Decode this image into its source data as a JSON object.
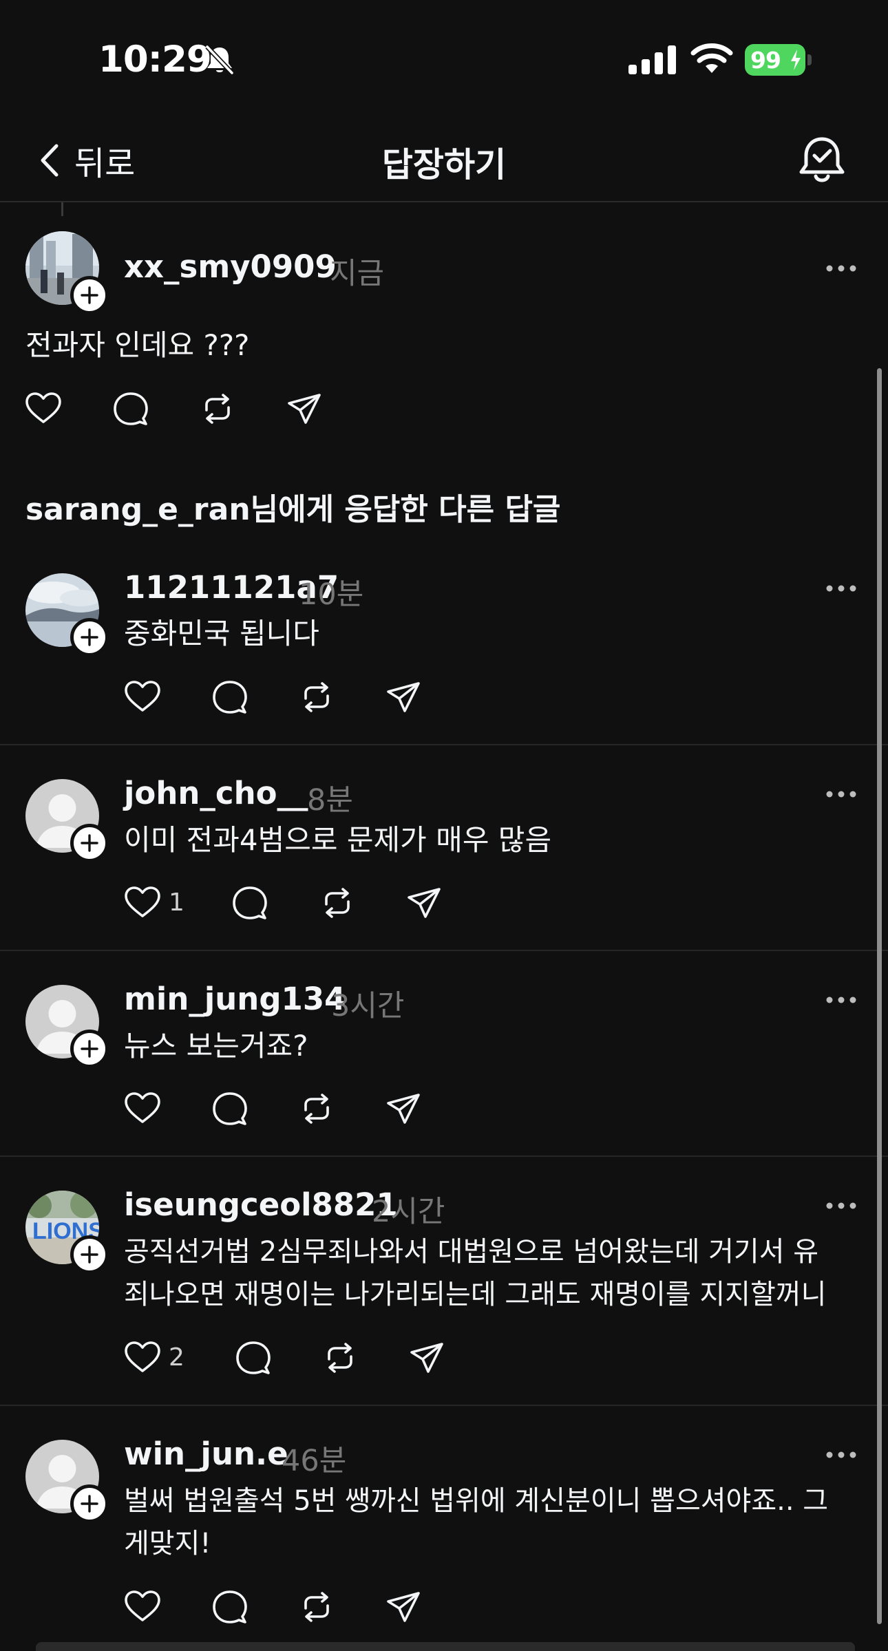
{
  "status_bar": {
    "time": "10:29",
    "battery": "99",
    "icons": [
      "bell-off-icon",
      "cellular-signal-icon",
      "wifi-icon",
      "battery-charging-icon"
    ]
  },
  "nav": {
    "back_label": "뒤로",
    "title": "답장하기",
    "icons": [
      "chevron-left-icon",
      "notification-bell-icon"
    ]
  },
  "main_reply": {
    "username": "xx_smy0909",
    "time": "지금",
    "text": "전과자 인데요 ???"
  },
  "other_replies_heading": "sarang_e_ran님에게 응답한 다른 답글",
  "replies": [
    {
      "username": "11211121a7",
      "time": "10분",
      "text": "중화민국 됩니다",
      "likes": ""
    },
    {
      "username": "john_cho__",
      "time": "8분",
      "text": "이미 전과4범으로 문제가 매우 많음",
      "likes": "1"
    },
    {
      "username": "min_jung134",
      "time": "3시간",
      "text": "뉴스 보는거죠?",
      "likes": ""
    },
    {
      "username": "iseungceol8821",
      "time": "2시간",
      "text": "공직선거법 2심무죄나와서 대법원으로 넘어왔는데 거기서 유\n죄나오면 재명이는 나가리되는데 그래도 재명이를 지지할꺼니",
      "likes": "2"
    },
    {
      "username": "win_jun.e",
      "time": "46분",
      "text": "벌써 법원출석 5번 쌩까신 법위에 계신분이니 뽑으셔야죠.. 그\n게맞지!",
      "likes": ""
    }
  ],
  "colors": {
    "background": "#101010",
    "text": "#f3f5f7",
    "secondary": "#777777",
    "battery": "#4fd65f"
  }
}
